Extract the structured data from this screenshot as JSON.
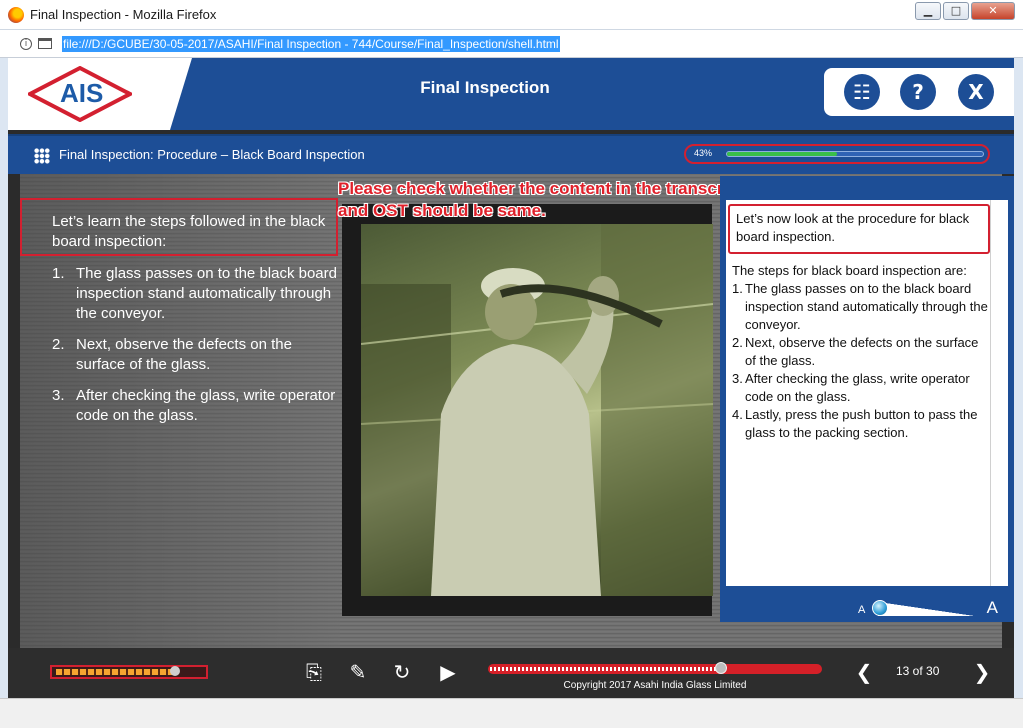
{
  "browser": {
    "window_title": "Final Inspection - Mozilla Firefox",
    "url": "file:///D:/GCUBE/30-05-2017/ASAHI/Final Inspection - 744/Course/Final_Inspection/shell.html",
    "buttons": {
      "minimize": "▁",
      "maximize": "□",
      "close": "✕"
    },
    "info_icon": "i"
  },
  "header": {
    "logo_text": "AIS",
    "title": "Final Inspection",
    "buttons": [
      {
        "name": "sitemap",
        "icon": "sitemap-icon",
        "glyph": "☷"
      },
      {
        "name": "help",
        "icon": "help-icon",
        "glyph": "?"
      },
      {
        "name": "exit",
        "icon": "close-icon",
        "glyph": "X"
      }
    ]
  },
  "topic": {
    "title": "Final Inspection: Procedure – Black Board Inspection",
    "progress_label": "43%",
    "progress_value": 0.43
  },
  "slide": {
    "intro": "Let’s learn the steps followed in the black board inspection:",
    "steps": [
      {
        "num": "1.",
        "text": "The glass passes on to the black board inspection stand automatically through the conveyor."
      },
      {
        "num": "2.",
        "text": "Next, observe the defects on the surface of the glass."
      },
      {
        "num": "3.",
        "text": "After checking the glass, write operator code on the glass."
      }
    ],
    "annotation": "Please check whether the content in the transcript and OST should be same."
  },
  "transcript": {
    "heading": "Let’s now look at the procedure for black board inspection.",
    "lead": "The steps for black board inspection are:",
    "items": [
      {
        "num": "1.",
        "text": "The glass passes on to the black board inspection stand automatically through the conveyor."
      },
      {
        "num": "2.",
        "text": "Next, observe the defects on the surface of the glass."
      },
      {
        "num": "3.",
        "text": "After checking the glass, write operator code on the glass."
      },
      {
        "num": "4.",
        "text": "Lastly, press the push button to pass the glass to the packing section."
      }
    ],
    "font_small": "A",
    "font_large": "A"
  },
  "footer": {
    "volume_level": 0.85,
    "seek_position": 0.7,
    "copyright": "Copyright 2017 Asahi India Glass Limited",
    "page": "13 of 30",
    "glyphs": {
      "transcript": "⎘",
      "notes": "✎",
      "replay": "↻",
      "play": "▶",
      "prev": "❮",
      "next": "❯"
    }
  },
  "colors": {
    "brand_blue": "#1d4e96",
    "highlight_red": "#d32030",
    "progress_green": "#39c04a"
  }
}
